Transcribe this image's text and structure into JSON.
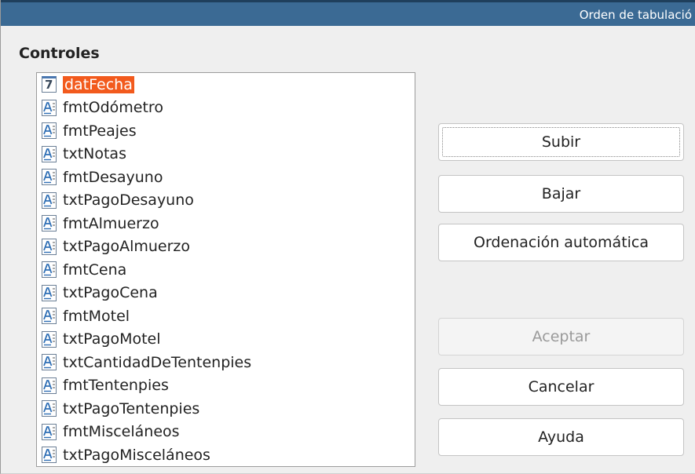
{
  "window": {
    "title": "Orden de tabulació"
  },
  "section": {
    "label": "Controles"
  },
  "list": {
    "items": [
      {
        "label": "datFecha",
        "icon": "date-field-icon",
        "selected": true
      },
      {
        "label": "fmtOdómetro",
        "icon": "text-field-icon"
      },
      {
        "label": "fmtPeajes",
        "icon": "text-field-icon"
      },
      {
        "label": "txtNotas",
        "icon": "text-field-icon"
      },
      {
        "label": "fmtDesayuno",
        "icon": "text-field-icon"
      },
      {
        "label": "txtPagoDesayuno",
        "icon": "text-field-icon"
      },
      {
        "label": "fmtAlmuerzo",
        "icon": "text-field-icon"
      },
      {
        "label": "txtPagoAlmuerzo",
        "icon": "text-field-icon"
      },
      {
        "label": "fmtCena",
        "icon": "text-field-icon"
      },
      {
        "label": "txtPagoCena",
        "icon": "text-field-icon"
      },
      {
        "label": "fmtMotel",
        "icon": "text-field-icon"
      },
      {
        "label": "txtPagoMotel",
        "icon": "text-field-icon"
      },
      {
        "label": "txtCantidadDeTentenpies",
        "icon": "text-field-icon"
      },
      {
        "label": "fmtTentenpies",
        "icon": "text-field-icon"
      },
      {
        "label": "txtPagoTentenpies",
        "icon": "text-field-icon"
      },
      {
        "label": "fmtMisceláneos",
        "icon": "text-field-icon"
      },
      {
        "label": "txtPagoMisceláneos",
        "icon": "text-field-icon"
      }
    ],
    "date_icon_glyph": "7"
  },
  "buttons": {
    "move_up": "Subir",
    "move_down": "Bajar",
    "auto_order": "Ordenación automática",
    "ok": "Aceptar",
    "cancel": "Cancelar",
    "help": "Ayuda"
  },
  "colors": {
    "titlebar": "#3b6a94",
    "selection": "#f25a1d"
  }
}
